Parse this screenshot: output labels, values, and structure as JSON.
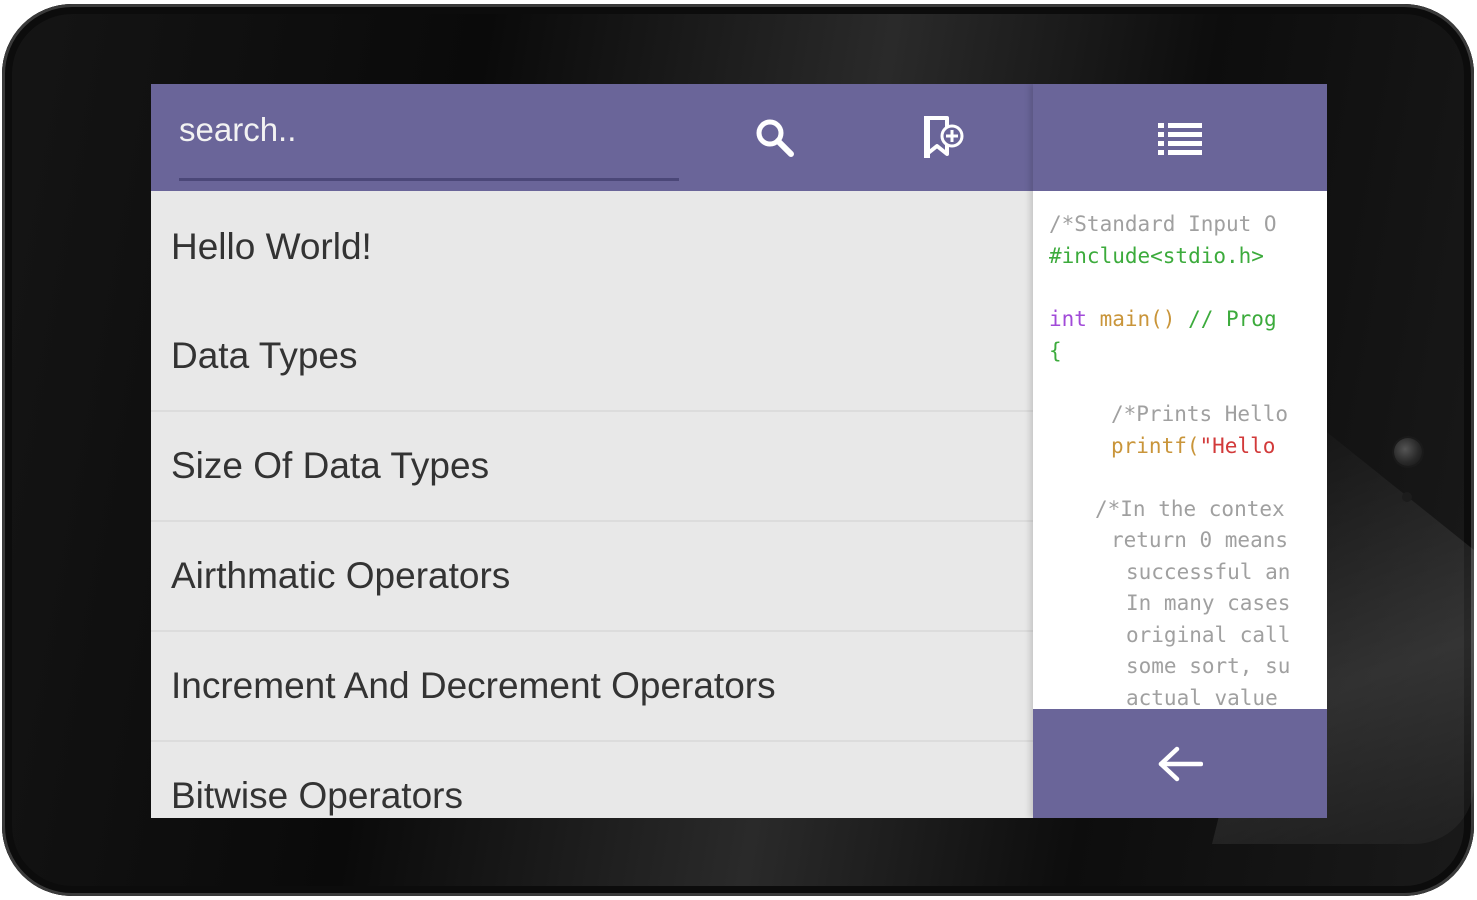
{
  "search": {
    "placeholder": "search.."
  },
  "toolbar": {
    "search_icon": "search-icon",
    "bookmark_icon": "bookmark-add-icon",
    "menu_icon": "list-menu-icon",
    "back_icon": "arrow-back-icon"
  },
  "topics": [
    "Hello World!",
    "Data Types",
    "Size Of Data Types",
    "Airthmatic Operators",
    "Increment And Decrement Operators",
    "Bitwise Operators"
  ],
  "code": {
    "line1": "/*Standard Input O",
    "line2": "#include<stdio.h>",
    "line3_kw": "int",
    "line3_fn": " main()",
    "line3_comment": " // Prog",
    "line4": "{",
    "line5": "/*Prints Hello",
    "line6_fn": "printf(",
    "line6_str": "\"Hello",
    "line7": "/*In the contex",
    "line8": "return 0 means",
    "line9": "successful an",
    "line10": "In many cases",
    "line11": "original call",
    "line12": "some sort, su",
    "line13": "actual value"
  },
  "colors": {
    "primary": "#6a6599",
    "list_bg": "#e8e8e8",
    "text": "#333333"
  }
}
